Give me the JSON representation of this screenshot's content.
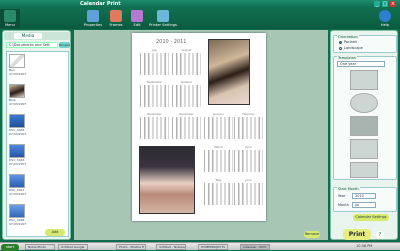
{
  "window": {
    "title": "Calendar Print",
    "menu": "Menu"
  },
  "toolbar": {
    "properties": "Properties",
    "frames": "Frames",
    "edit": "Edit",
    "printer_settings": "Printer Settings",
    "help": "Help"
  },
  "left_panel": {
    "tab": "Media",
    "path": "C:\\Documents and Sett",
    "browse": "Browse",
    "thumbnails": [
      {
        "name": "Ban",
        "date": "07/03/2007"
      },
      {
        "name": "Bhie",
        "date": "07/03/2007"
      },
      {
        "name": "DSC_0045",
        "date": "07/03/2007"
      },
      {
        "name": "DSC_0046",
        "date": "07/03/2007"
      },
      {
        "name": "DSC_0047",
        "date": "07/03/2007"
      },
      {
        "name": "DSC_0048",
        "date": "07/03/2007"
      }
    ],
    "add": "Add"
  },
  "calendar": {
    "title": "2010 - 2011",
    "months": [
      "July",
      "August",
      "September",
      "October",
      "November",
      "December",
      "January",
      "February",
      "March",
      "April",
      "May",
      "June"
    ]
  },
  "main": {
    "remove": "Remove"
  },
  "right_panel": {
    "orientation_label": "Orientation",
    "portrait": "Portrait",
    "landscape": "Landscape",
    "templates_label": "Templates",
    "template_select": "One year",
    "start_month_label": "Start Month",
    "year_label": "Year",
    "year_value": "2010",
    "month_label": "Month",
    "month_value": "Jul",
    "calendar_settings": "Calendar Settings"
  },
  "actions": {
    "print": "Print",
    "help": "?"
  },
  "taskbar": {
    "start": "start",
    "tasks": [
      "Nokia Photo",
      "Untitled Google",
      "Photo - Mozilla Fi",
      "Untitled - Notepad",
      "HOMEPROJECTS",
      "Calendar - Print"
    ],
    "clock": "10:38 PM"
  },
  "colors": {
    "theme_green": "#0e6b4e",
    "panel_bg": "#e9f4ee",
    "button_yellow": "#d7e96f"
  }
}
